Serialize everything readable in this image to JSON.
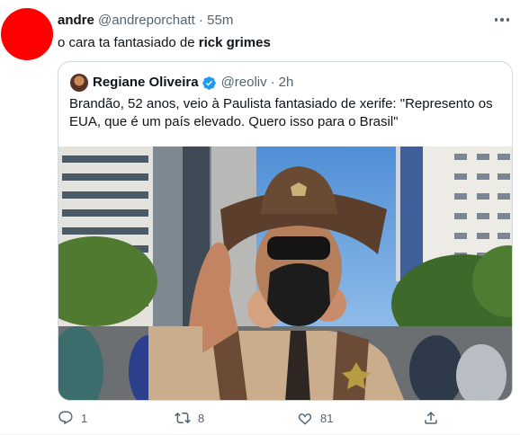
{
  "tweet": {
    "author_name": "andre",
    "author_handle": "@andreporchatt",
    "separator": "·",
    "time": "55m",
    "text_prefix": "o cara ta fantasiado de ",
    "text_bold": "rick grimes"
  },
  "quoted_tweet": {
    "author_name": "Regiane Oliveira",
    "author_handle": "@reoliv",
    "separator": "·",
    "time": "2h",
    "text": "Brandão, 52 anos, veio à Paulista fantasiado de xerife: \"Represento os EUA, que é um país elevado. Quero isso para o Brasil\""
  },
  "actions": {
    "reply_count": "1",
    "retweet_count": "8",
    "like_count": "81"
  },
  "icons": {
    "more": "more-icon",
    "verified": "verified-badge-icon",
    "reply": "reply-icon",
    "retweet": "retweet-icon",
    "like": "like-icon",
    "share": "share-icon"
  },
  "colors": {
    "avatar": "#ff0000",
    "verified": "#1d9bf0",
    "secondary_text": "#536471",
    "border": "#cfd9de"
  }
}
